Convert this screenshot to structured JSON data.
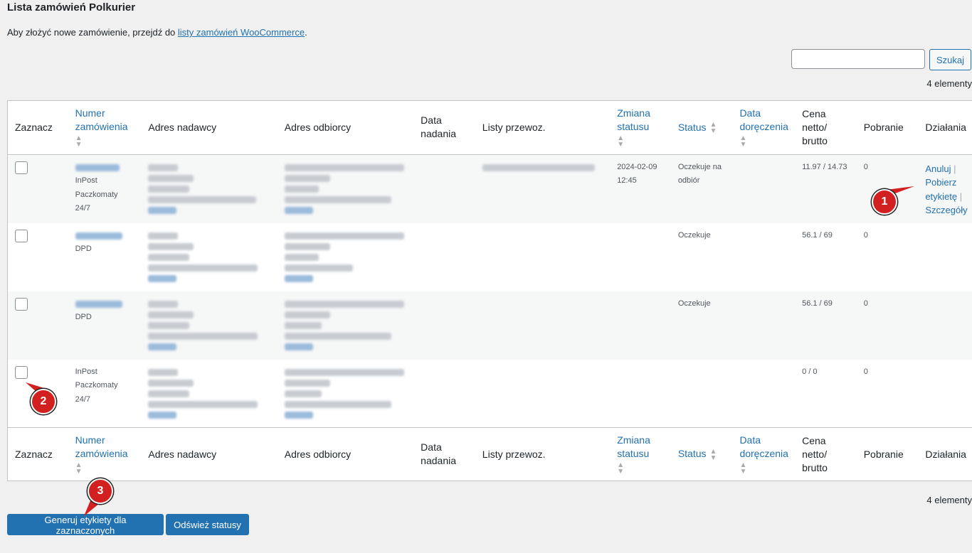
{
  "page": {
    "title": "Lista zamówień Polkurier",
    "intro_prefix": "Aby złożyć nowe zamówienie, przejdź do ",
    "intro_link": "listy zamówień WooCommerce",
    "intro_suffix": "."
  },
  "search": {
    "button": "Szukaj",
    "placeholder": ""
  },
  "item_count": "4 elementy",
  "columns": {
    "select": "Zaznacz",
    "order_no": "Numer zamówienia",
    "sender": "Adres nadawcy",
    "recipient": "Adres odbiorcy",
    "send_date": "Data nadania",
    "waybills": "Listy przewoz.",
    "status_change": "Zmiana statusu",
    "status": "Status",
    "delivery_date": "Data doręczenia",
    "price": "Cena netto/ brutto",
    "cod": "Pobranie",
    "actions": "Działania"
  },
  "rows": [
    {
      "carrier": "InPost Paczkomaty 24/7",
      "status_change": "2024-02-09 12:45",
      "status": "Oczekuje na odbiór",
      "price": "11.97 / 14.73",
      "cod": "0",
      "actions": {
        "cancel": "Anuluj",
        "label": "Pobierz etykietę",
        "details": "Szczegóły",
        "sep": "|"
      }
    },
    {
      "carrier": "DPD",
      "status_change": "",
      "status": "Oczekuje",
      "price": "56.1 / 69",
      "cod": "0"
    },
    {
      "carrier": "DPD",
      "status_change": "",
      "status": "Oczekuje",
      "price": "56.1 / 69",
      "cod": "0"
    },
    {
      "carrier": "InPost Paczkomaty 24/7",
      "status_change": "",
      "status": "",
      "price": "0 / 0",
      "cod": "0"
    }
  ],
  "buttons": {
    "generate": "Generuj etykiety dla zaznaczonych",
    "refresh": "Odśwież statusy"
  },
  "markers": [
    "1",
    "2",
    "3"
  ],
  "colors": {
    "accent": "#2271b1",
    "marker": "#d21f1f",
    "background": "#f0f0f1"
  }
}
